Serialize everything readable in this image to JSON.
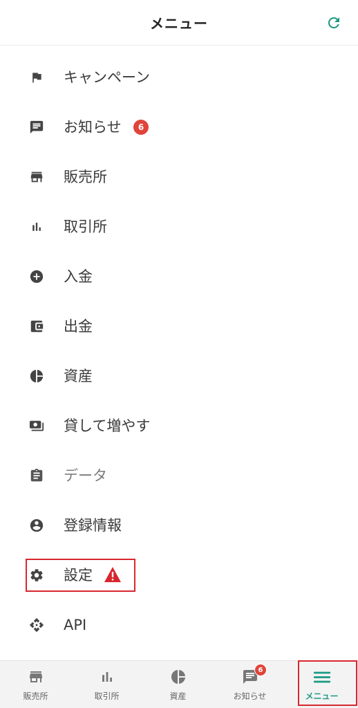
{
  "header": {
    "title": "メニュー",
    "refresh_icon": "refresh-icon",
    "accent_color": "#1a9a82"
  },
  "menu": {
    "items": [
      {
        "label": "キャンペーン",
        "icon": "flag-icon"
      },
      {
        "label": "お知らせ",
        "icon": "message-icon",
        "badge": "6"
      },
      {
        "label": "販売所",
        "icon": "store-icon"
      },
      {
        "label": "取引所",
        "icon": "bar-chart-icon"
      },
      {
        "label": "入金",
        "icon": "plus-circle-icon"
      },
      {
        "label": "出金",
        "icon": "wallet-icon"
      },
      {
        "label": "資産",
        "icon": "pie-chart-icon"
      },
      {
        "label": "貸して増やす",
        "icon": "money-icon"
      },
      {
        "label": "データ",
        "icon": "clipboard-icon"
      },
      {
        "label": "登録情報",
        "icon": "account-circle-icon"
      },
      {
        "label": "設定",
        "icon": "gear-icon",
        "warning_icon": "warning-icon"
      },
      {
        "label": "API",
        "icon": "api-icon"
      }
    ]
  },
  "tabbar": {
    "tabs": [
      {
        "label": "販売所",
        "icon": "store-icon"
      },
      {
        "label": "取引所",
        "icon": "bar-chart-icon"
      },
      {
        "label": "資産",
        "icon": "pie-chart-icon"
      },
      {
        "label": "お知らせ",
        "icon": "message-icon",
        "badge": "6"
      },
      {
        "label": "メニュー",
        "icon": "menu-icon",
        "active": true
      }
    ]
  },
  "colors": {
    "badge": "#e0443a",
    "highlight": "#d8262f",
    "icon": "#444444"
  }
}
